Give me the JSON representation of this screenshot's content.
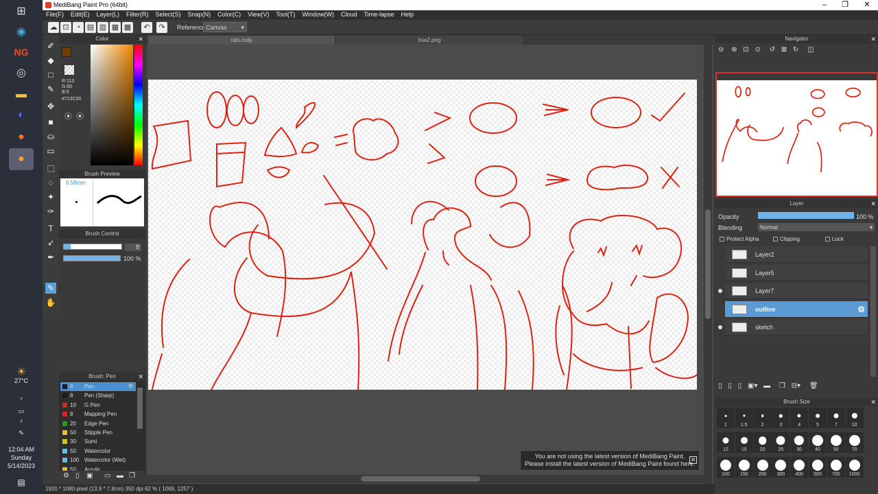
{
  "app": {
    "title": "MediBang Paint Pro (64bit)"
  },
  "menu": [
    "File(F)",
    "Edit(E)",
    "Layer(L)",
    "Filter(R)",
    "Select(S)",
    "Snap(N)",
    "Color(C)",
    "View(V)",
    "Tool(T)",
    "Window(W)",
    "Cloud",
    "Time-lapse",
    "Help"
  ],
  "toolbar": {
    "reference_label": "Reference",
    "reference_value": "Canvas"
  },
  "taskbar": {
    "weather": "27°C",
    "time": "12:04 AM",
    "day": "Sunday",
    "date": "5/14/2023"
  },
  "color_panel": {
    "title": "Color",
    "r": "R:113",
    "g": "G:60",
    "b": "B:0",
    "hex": "#713C00",
    "primary": "#713c00",
    "secondary": "#f5c36b"
  },
  "brush_preview": {
    "title": "Brush Preview",
    "size": "0.58mm"
  },
  "brush_control": {
    "title": "Brush Control",
    "size": "8",
    "opacity": "100 %",
    "opacity_value": 100
  },
  "brush_list": {
    "title": "Brush: Pen",
    "items": [
      {
        "size": "8",
        "name": "Pen",
        "color": "#1b1b1b",
        "active": true
      },
      {
        "size": "8",
        "name": "Pen (Sharp)",
        "color": "#1b1b1b"
      },
      {
        "size": "10",
        "name": "G Pen",
        "color": "#e02020"
      },
      {
        "size": "8",
        "name": "Mapping Pen",
        "color": "#e02020"
      },
      {
        "size": "20",
        "name": "Edge Pen",
        "color": "#20a020"
      },
      {
        "size": "50",
        "name": "Stipple Pen",
        "color": "#e0c020"
      },
      {
        "size": "30",
        "name": "Sumi",
        "color": "#e0c020"
      },
      {
        "size": "50",
        "name": "Watercolor",
        "color": "#60c0e0"
      },
      {
        "size": "100",
        "name": "Watercolor (Wet)",
        "color": "#60c0e0"
      },
      {
        "size": "50",
        "name": "Acrylic",
        "color": "#e0c020"
      }
    ]
  },
  "documents": {
    "tab1": "rats.mdp",
    "tab2": "hsa2.png"
  },
  "status": {
    "text": "1920 * 1080 pixel   (13.9 * 7.8cm)   350 dpi   62 %   ( 1069, 1257 )"
  },
  "notice": {
    "line1": "You are not using the latest version of MediBang Paint.",
    "line2": "Please install the latest version of MediBang Paint found here."
  },
  "navigator": {
    "title": "Navigator"
  },
  "layer_panel": {
    "title": "Layer",
    "opacity_label": "Opacity",
    "opacity_value": "100 %",
    "opacity_level": 100,
    "blending_label": "Blending",
    "blending_value": "Normal",
    "protect_alpha": "Protect Alpha",
    "clipping": "Clipping",
    "lock": "Lock",
    "layers": [
      {
        "name": "Layer2",
        "visible": false,
        "active": false
      },
      {
        "name": "Layer5",
        "visible": false,
        "active": false
      },
      {
        "name": "Layer7",
        "visible": true,
        "active": false
      },
      {
        "name": "outline",
        "visible": false,
        "active": true
      },
      {
        "name": "sketch",
        "visible": true,
        "active": false
      }
    ]
  },
  "brush_size": {
    "title": "Brush Size",
    "sizes": [
      "1",
      "1.5",
      "2",
      "3",
      "4",
      "5",
      "7",
      "10",
      "12",
      "15",
      "20",
      "25",
      "30",
      "40",
      "50",
      "70",
      "100",
      "150",
      "200",
      "300",
      "400",
      "500",
      "700",
      "1000"
    ]
  }
}
